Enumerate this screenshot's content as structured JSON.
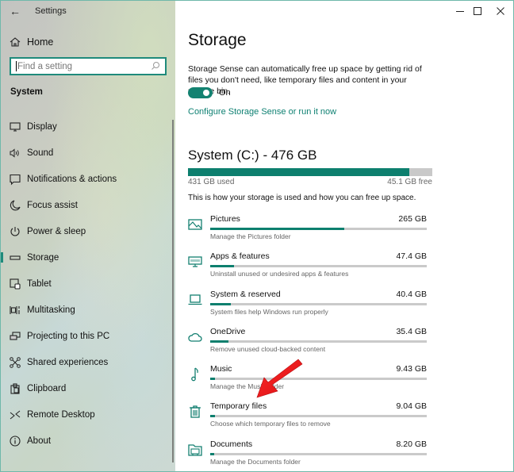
{
  "window": {
    "title": "Settings",
    "controls": {
      "minimize": "minimize-icon",
      "maximize": "maximize-icon",
      "close": "close-icon"
    },
    "accent_color": "#1f8a7b"
  },
  "sidebar": {
    "back_icon": "back-arrow-icon",
    "home": {
      "label": "Home",
      "icon": "home-icon"
    },
    "search": {
      "placeholder": "Find a setting",
      "value": "",
      "icon": "search-icon"
    },
    "section_label": "System",
    "items": [
      {
        "label": "Display",
        "icon": "display-icon",
        "active": false
      },
      {
        "label": "Sound",
        "icon": "sound-icon",
        "active": false
      },
      {
        "label": "Notifications & actions",
        "icon": "notifications-icon",
        "active": false
      },
      {
        "label": "Focus assist",
        "icon": "moon-icon",
        "active": false
      },
      {
        "label": "Power & sleep",
        "icon": "power-icon",
        "active": false
      },
      {
        "label": "Storage",
        "icon": "storage-icon",
        "active": true
      },
      {
        "label": "Tablet",
        "icon": "tablet-icon",
        "active": false
      },
      {
        "label": "Multitasking",
        "icon": "multitasking-icon",
        "active": false
      },
      {
        "label": "Projecting to this PC",
        "icon": "projecting-icon",
        "active": false
      },
      {
        "label": "Shared experiences",
        "icon": "shared-experiences-icon",
        "active": false
      },
      {
        "label": "Clipboard",
        "icon": "clipboard-icon",
        "active": false
      },
      {
        "label": "Remote Desktop",
        "icon": "remote-desktop-icon",
        "active": false
      },
      {
        "label": "About",
        "icon": "info-icon",
        "active": false
      }
    ]
  },
  "main": {
    "title": "Storage",
    "description": "Storage Sense can automatically free up space by getting rid of files you don't need, like temporary files and content in your recycle bin.",
    "storage_sense": {
      "state": "On",
      "enabled": true
    },
    "configure_link": "Configure Storage Sense or run it now",
    "drive": {
      "title": "System (C:) - 476 GB",
      "used_label": "431 GB used",
      "free_label": "45.1 GB free",
      "used_fraction": 0.905
    },
    "help_text": "This is how your storage is used and how you can free up space.",
    "categories": [
      {
        "name": "Pictures",
        "size": "265 GB",
        "subtitle": "Manage the Pictures folder",
        "icon": "pictures-icon",
        "fraction": 0.62
      },
      {
        "name": "Apps & features",
        "size": "47.4 GB",
        "subtitle": "Uninstall unused or undesired apps & features",
        "icon": "apps-icon",
        "fraction": 0.11
      },
      {
        "name": "System & reserved",
        "size": "40.4 GB",
        "subtitle": "System files help Windows run properly",
        "icon": "laptop-icon",
        "fraction": 0.095
      },
      {
        "name": "OneDrive",
        "size": "35.4 GB",
        "subtitle": "Remove unused cloud-backed content",
        "icon": "cloud-icon",
        "fraction": 0.083
      },
      {
        "name": "Music",
        "size": "9.43 GB",
        "subtitle": "Manage the Music folder",
        "icon": "music-icon",
        "fraction": 0.022
      },
      {
        "name": "Temporary files",
        "size": "9.04 GB",
        "subtitle": "Choose which temporary files to remove",
        "icon": "trash-icon",
        "fraction": 0.021
      },
      {
        "name": "Documents",
        "size": "8.20 GB",
        "subtitle": "Manage the Documents folder",
        "icon": "documents-icon",
        "fraction": 0.019
      }
    ],
    "annotation": {
      "type": "red-arrow",
      "points_to": "Temporary files",
      "color": "#e8141a"
    }
  }
}
